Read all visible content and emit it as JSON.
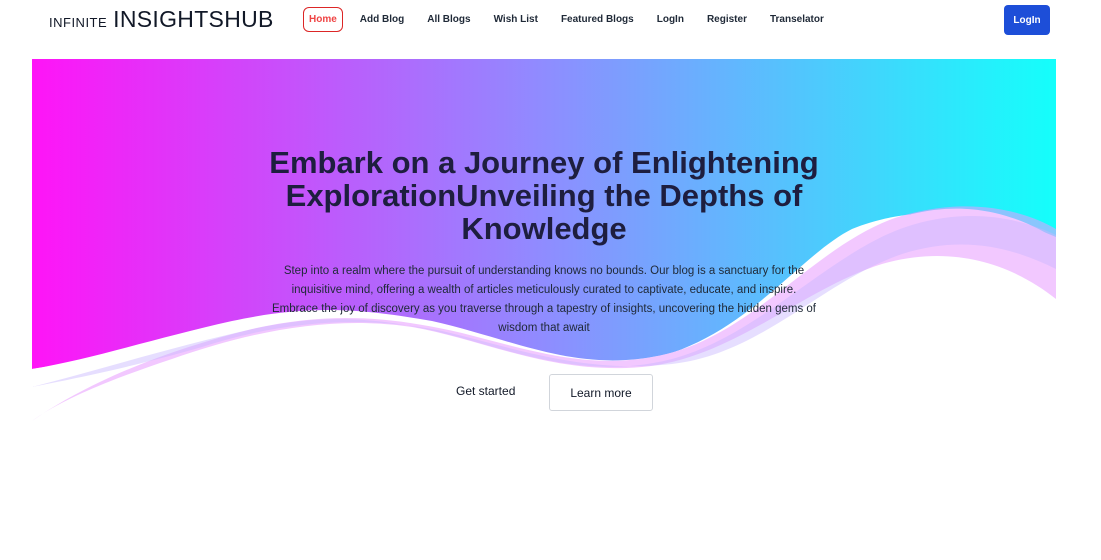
{
  "brand": {
    "small": "INFINITE",
    "large": "INSIGHTSHUB"
  },
  "nav": {
    "items": [
      {
        "label": "Home",
        "active": true
      },
      {
        "label": "Add Blog",
        "active": false
      },
      {
        "label": "All Blogs",
        "active": false
      },
      {
        "label": "Wish List",
        "active": false
      },
      {
        "label": "Featured Blogs",
        "active": false
      },
      {
        "label": "LogIn",
        "active": false
      },
      {
        "label": "Register",
        "active": false
      },
      {
        "label": "Transelator",
        "active": false
      }
    ],
    "login_button": "LogIn"
  },
  "hero": {
    "title": "Embark on a Journey of Enlightening ExplorationUnveiling the Depths of Knowledge",
    "description": "Step into a realm where the pursuit of understanding knows no bounds. Our blog is a sanctuary for the inquisitive mind, offering a wealth of articles meticulously curated to captivate, educate, and inspire. Embrace the joy of discovery as you traverse through a tapestry of insights, uncovering the hidden gems of wisdom that await",
    "primary_button": "Get started",
    "secondary_button": "Learn more"
  },
  "colors": {
    "gradient_start": "#ff14f7",
    "gradient_mid": "#8f8cff",
    "gradient_end": "#14fffb",
    "active_nav": "#ef4444",
    "login_bg": "#1d4ed8"
  }
}
